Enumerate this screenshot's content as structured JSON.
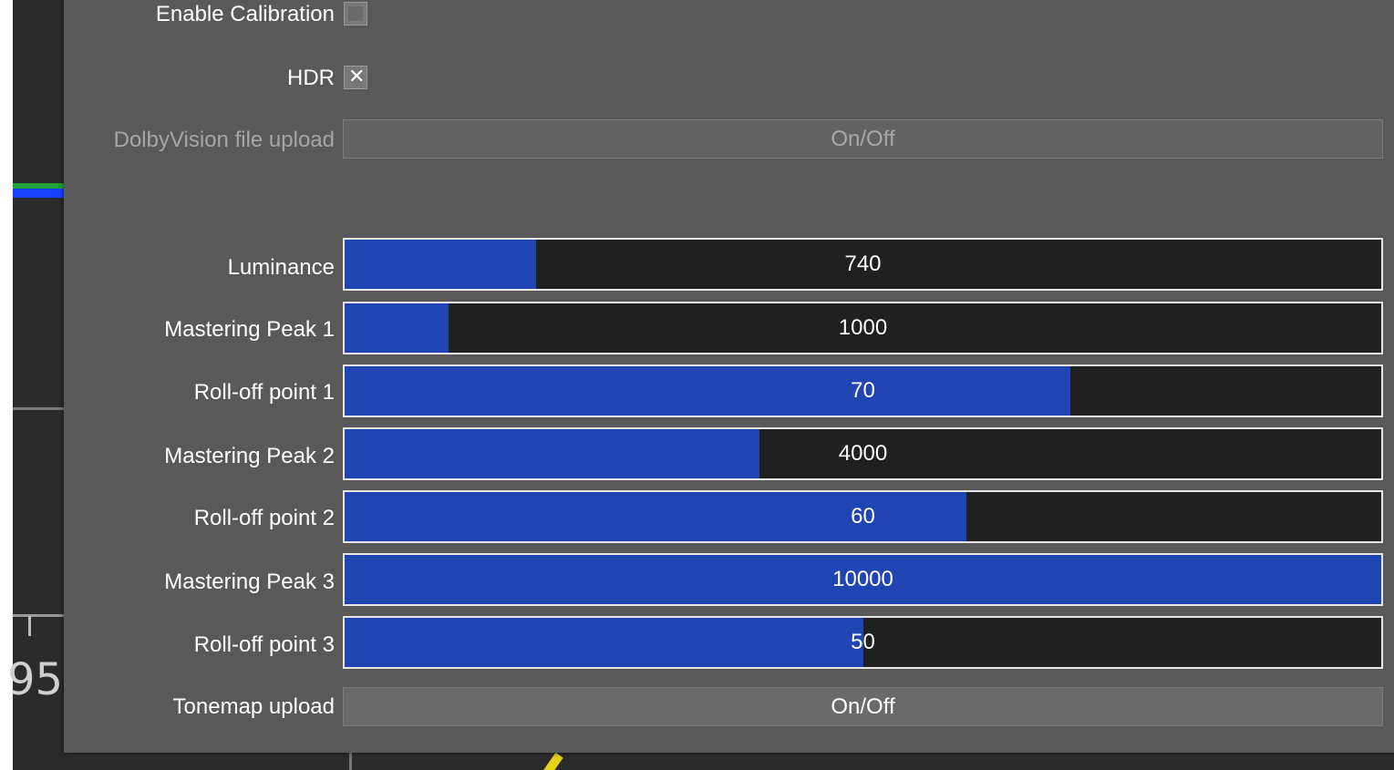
{
  "panel": {
    "enable_calibration": {
      "label": "Enable Calibration",
      "checked": false
    },
    "hdr": {
      "label": "HDR",
      "checked": true,
      "check_glyph": "✕"
    },
    "dolbyvision": {
      "label": "DolbyVision file upload",
      "button_label": "On/Off",
      "enabled": false
    },
    "sliders": [
      {
        "label": "Luminance",
        "value": "740",
        "fill_fraction": 0.185
      },
      {
        "label": "Mastering Peak 1",
        "value": "1000",
        "fill_fraction": 0.1
      },
      {
        "label": "Roll-off point 1",
        "value": "70",
        "fill_fraction": 0.7
      },
      {
        "label": "Mastering Peak 2",
        "value": "4000",
        "fill_fraction": 0.4
      },
      {
        "label": "Roll-off point 2",
        "value": "60",
        "fill_fraction": 0.6
      },
      {
        "label": "Mastering Peak 3",
        "value": "10000",
        "fill_fraction": 1.0
      },
      {
        "label": "Roll-off point 3",
        "value": "50",
        "fill_fraction": 0.5
      }
    ],
    "tonemap": {
      "label": "Tonemap upload",
      "button_label": "On/Off",
      "enabled": true
    }
  },
  "background": {
    "scale_number": "95"
  },
  "colors": {
    "slider_fill": "#2144b3",
    "panel_bg": "#595959"
  }
}
